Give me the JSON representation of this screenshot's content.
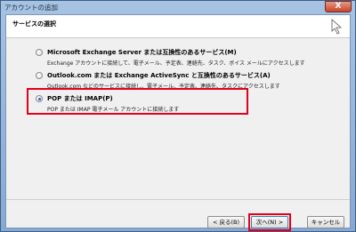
{
  "window": {
    "title": "アカウントの追加",
    "close_glyph": "X"
  },
  "header": {
    "title": "サービスの選択"
  },
  "options": [
    {
      "label": "Microsoft Exchange Server または互換性のあるサービス(M)",
      "description": "Exchange アカウントに接続して、電子メール、予定表、連絡先、タスク、ボイス メールにアクセスします",
      "selected": false
    },
    {
      "label": "Outlook.com または Exchange ActiveSync と互換性のあるサービス(A)",
      "description": "Outlook.com などのサービスに接続し、電子メール、予定表、連絡先、タスクにアクセスします",
      "selected": false
    },
    {
      "label": "POP または IMAP(P)",
      "description": "POP または IMAP 電子メール アカウントに接続します",
      "selected": true
    }
  ],
  "buttons": {
    "back": "< 戻る(B)",
    "next": "次へ(N) >",
    "cancel": "キャンセル"
  },
  "colors": {
    "highlight": "#e2001a",
    "client_bg": "#f0f0f0",
    "titlebar": "#a7c3e3"
  }
}
